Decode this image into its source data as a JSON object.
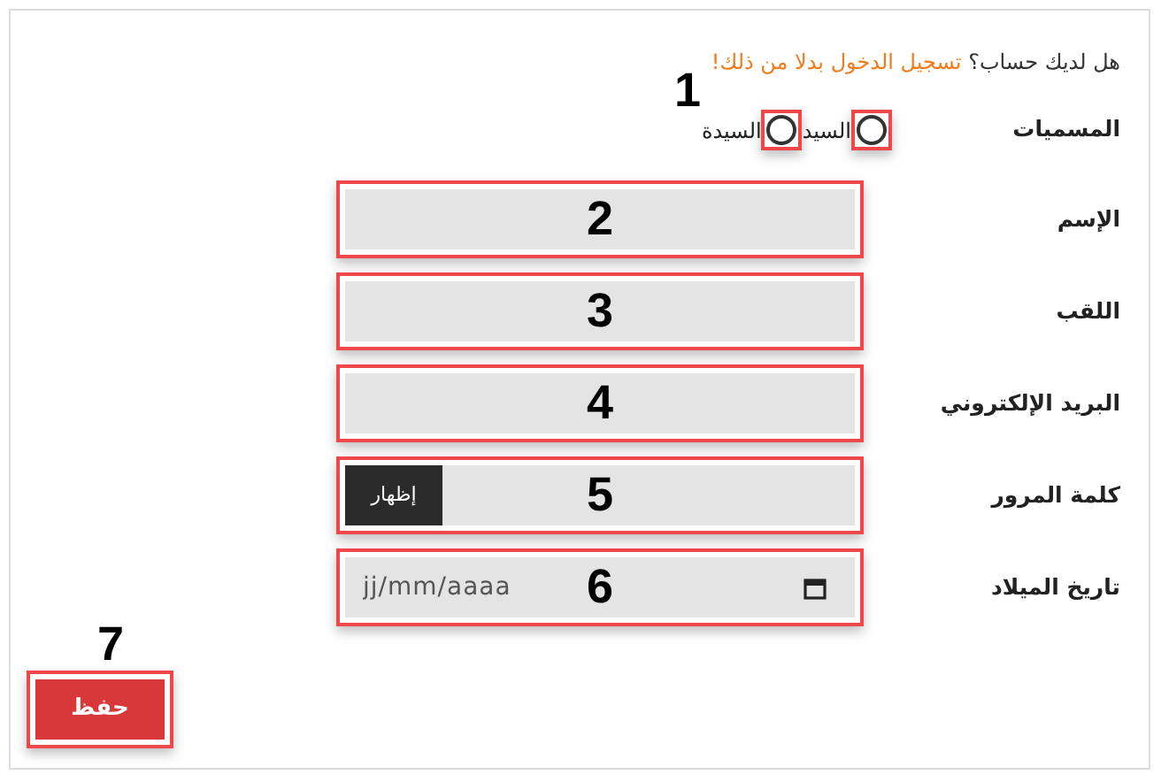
{
  "login_prompt": {
    "text": "هل لديك حساب؟",
    "link": "تسجيل الدخول بدلا من ذلك!"
  },
  "title_field": {
    "label": "المسميات",
    "annotation": "1",
    "options": [
      {
        "label": "السيد",
        "selected": false
      },
      {
        "label": "السيدة",
        "selected": false
      }
    ]
  },
  "fields": [
    {
      "kind": "text",
      "label": "الإسم",
      "annotation": "2"
    },
    {
      "kind": "text",
      "label": "اللقب",
      "annotation": "3"
    },
    {
      "kind": "text",
      "label": "البريد الإلكتروني",
      "annotation": "4"
    },
    {
      "kind": "password",
      "label": "كلمة المرور",
      "button": "إظهار",
      "annotation": "5"
    },
    {
      "kind": "date",
      "label": "تاريخ الميلاد",
      "placeholder": "jj/mm/aaaa",
      "annotation": "6"
    }
  ],
  "save_button": {
    "label": "حفظ",
    "annotation": "7"
  }
}
